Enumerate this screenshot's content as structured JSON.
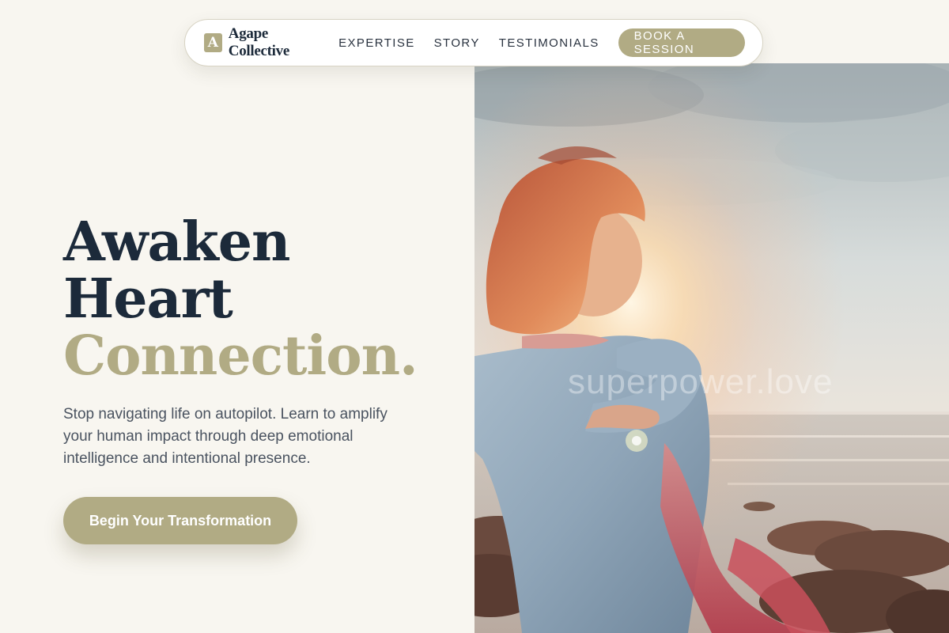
{
  "nav": {
    "logo_letter": "A",
    "brand_name": "Agape Collective",
    "links": [
      "EXPERTISE",
      "STORY",
      "TESTIMONIALS"
    ],
    "cta_label": "BOOK A SESSION"
  },
  "hero": {
    "headline_line1": "Awaken",
    "headline_line2": "Heart",
    "headline_line3": "Connection.",
    "subtext": "Stop navigating life on autopilot. Learn to amplify your human impact through deep emotional intelligence and intentional presence.",
    "cta_label": "Begin Your Transformation",
    "image_watermark": "superpower.love"
  },
  "colors": {
    "background": "#f8f6f0",
    "accent": "#b1ab84",
    "heading_dark": "#1c2a3a",
    "body_text": "#4a5360"
  }
}
